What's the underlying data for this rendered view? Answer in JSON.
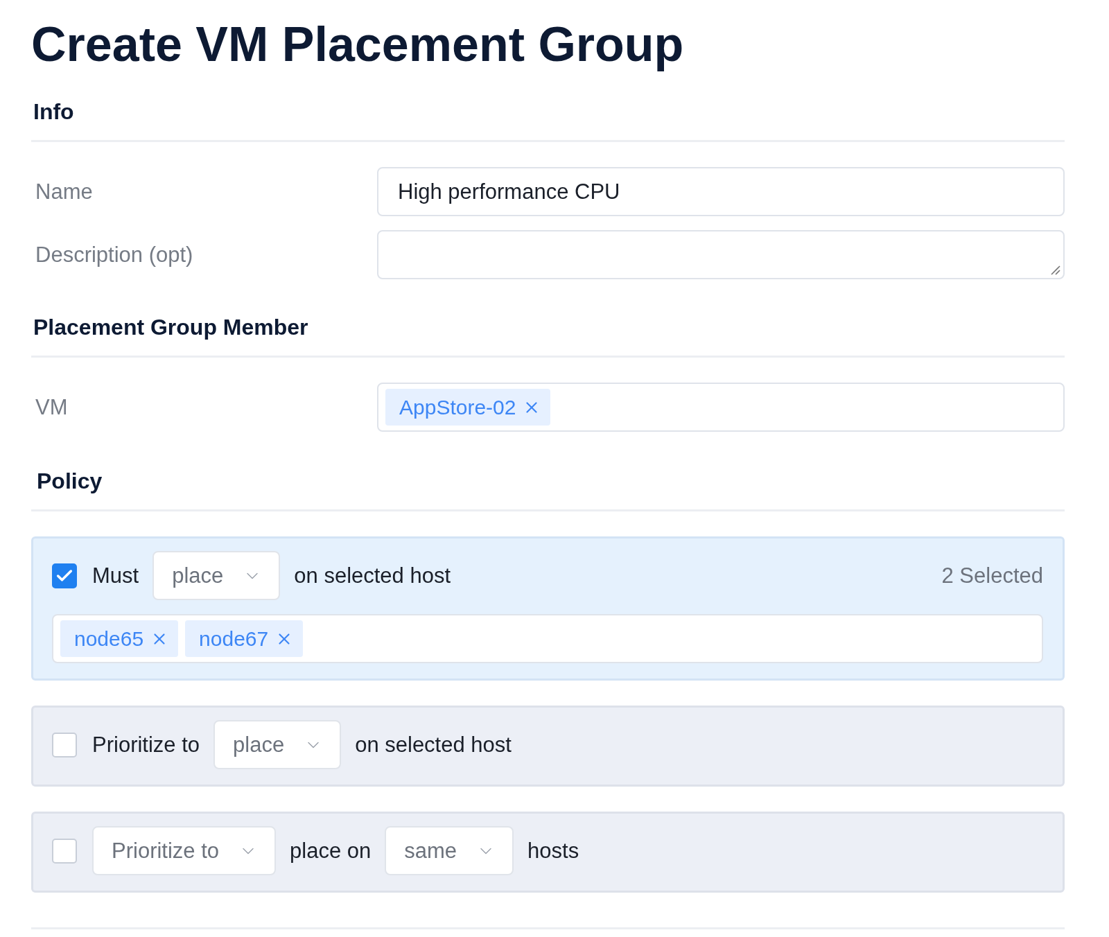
{
  "title": "Create VM Placement Group",
  "info": {
    "heading": "Info",
    "fields": [
      {
        "label": "Name",
        "kind": "text",
        "value": "High performance CPU"
      },
      {
        "label": "Description (opt)",
        "kind": "textarea"
      }
    ]
  },
  "member": {
    "heading": "Placement Group Member",
    "fields": [
      {
        "label": "VM",
        "kind": "tags",
        "tags": [
          "AppStore-02"
        ]
      }
    ]
  },
  "policy": {
    "heading": "Policy",
    "rules": [
      {
        "checked": true,
        "parts": [
          {
            "kind": "text",
            "text": "Must"
          },
          {
            "kind": "select",
            "value": "place"
          },
          {
            "kind": "text",
            "text": "on selected host"
          }
        ],
        "count": "2 Selected",
        "tags": [
          "node65",
          "node67"
        ]
      },
      {
        "checked": false,
        "parts": [
          {
            "kind": "text",
            "text": "Prioritize to"
          },
          {
            "kind": "select",
            "value": "place"
          },
          {
            "kind": "text",
            "text": "on selected host"
          }
        ]
      },
      {
        "checked": false,
        "parts": [
          {
            "kind": "select",
            "value": "Prioritize to"
          },
          {
            "kind": "text",
            "text": "place on"
          },
          {
            "kind": "select",
            "value": "same"
          },
          {
            "kind": "text",
            "text": "hosts"
          }
        ]
      }
    ]
  }
}
